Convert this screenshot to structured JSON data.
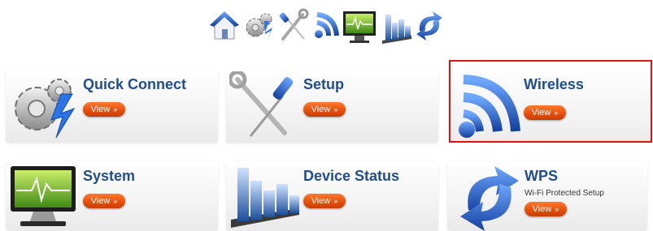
{
  "top_icons": [
    {
      "name": "home-icon"
    },
    {
      "name": "gears-icon"
    },
    {
      "name": "tools-icon"
    },
    {
      "name": "wireless-icon"
    },
    {
      "name": "monitor-icon"
    },
    {
      "name": "bar-chart-icon"
    },
    {
      "name": "sync-arrows-icon"
    }
  ],
  "tiles": [
    {
      "title": "Quick Connect",
      "button": "View",
      "icon": "gears-lightning-icon"
    },
    {
      "title": "Setup",
      "button": "View",
      "icon": "wrench-screwdriver-icon"
    },
    {
      "title": "Wireless",
      "button": "View",
      "icon": "wireless-signal-icon",
      "selected": true
    },
    {
      "title": "System",
      "button": "View",
      "icon": "monitor-graph-icon"
    },
    {
      "title": "Device Status",
      "button": "View",
      "icon": "bar-chart-icon"
    },
    {
      "title": "WPS",
      "subtitle": "Wi-Fi Protected Setup",
      "button": "View",
      "icon": "sync-arrows-icon"
    }
  ],
  "colors": {
    "title_blue": "#1f4d8f",
    "button_orange": "#e8500c",
    "selected_border": "#e01010"
  }
}
